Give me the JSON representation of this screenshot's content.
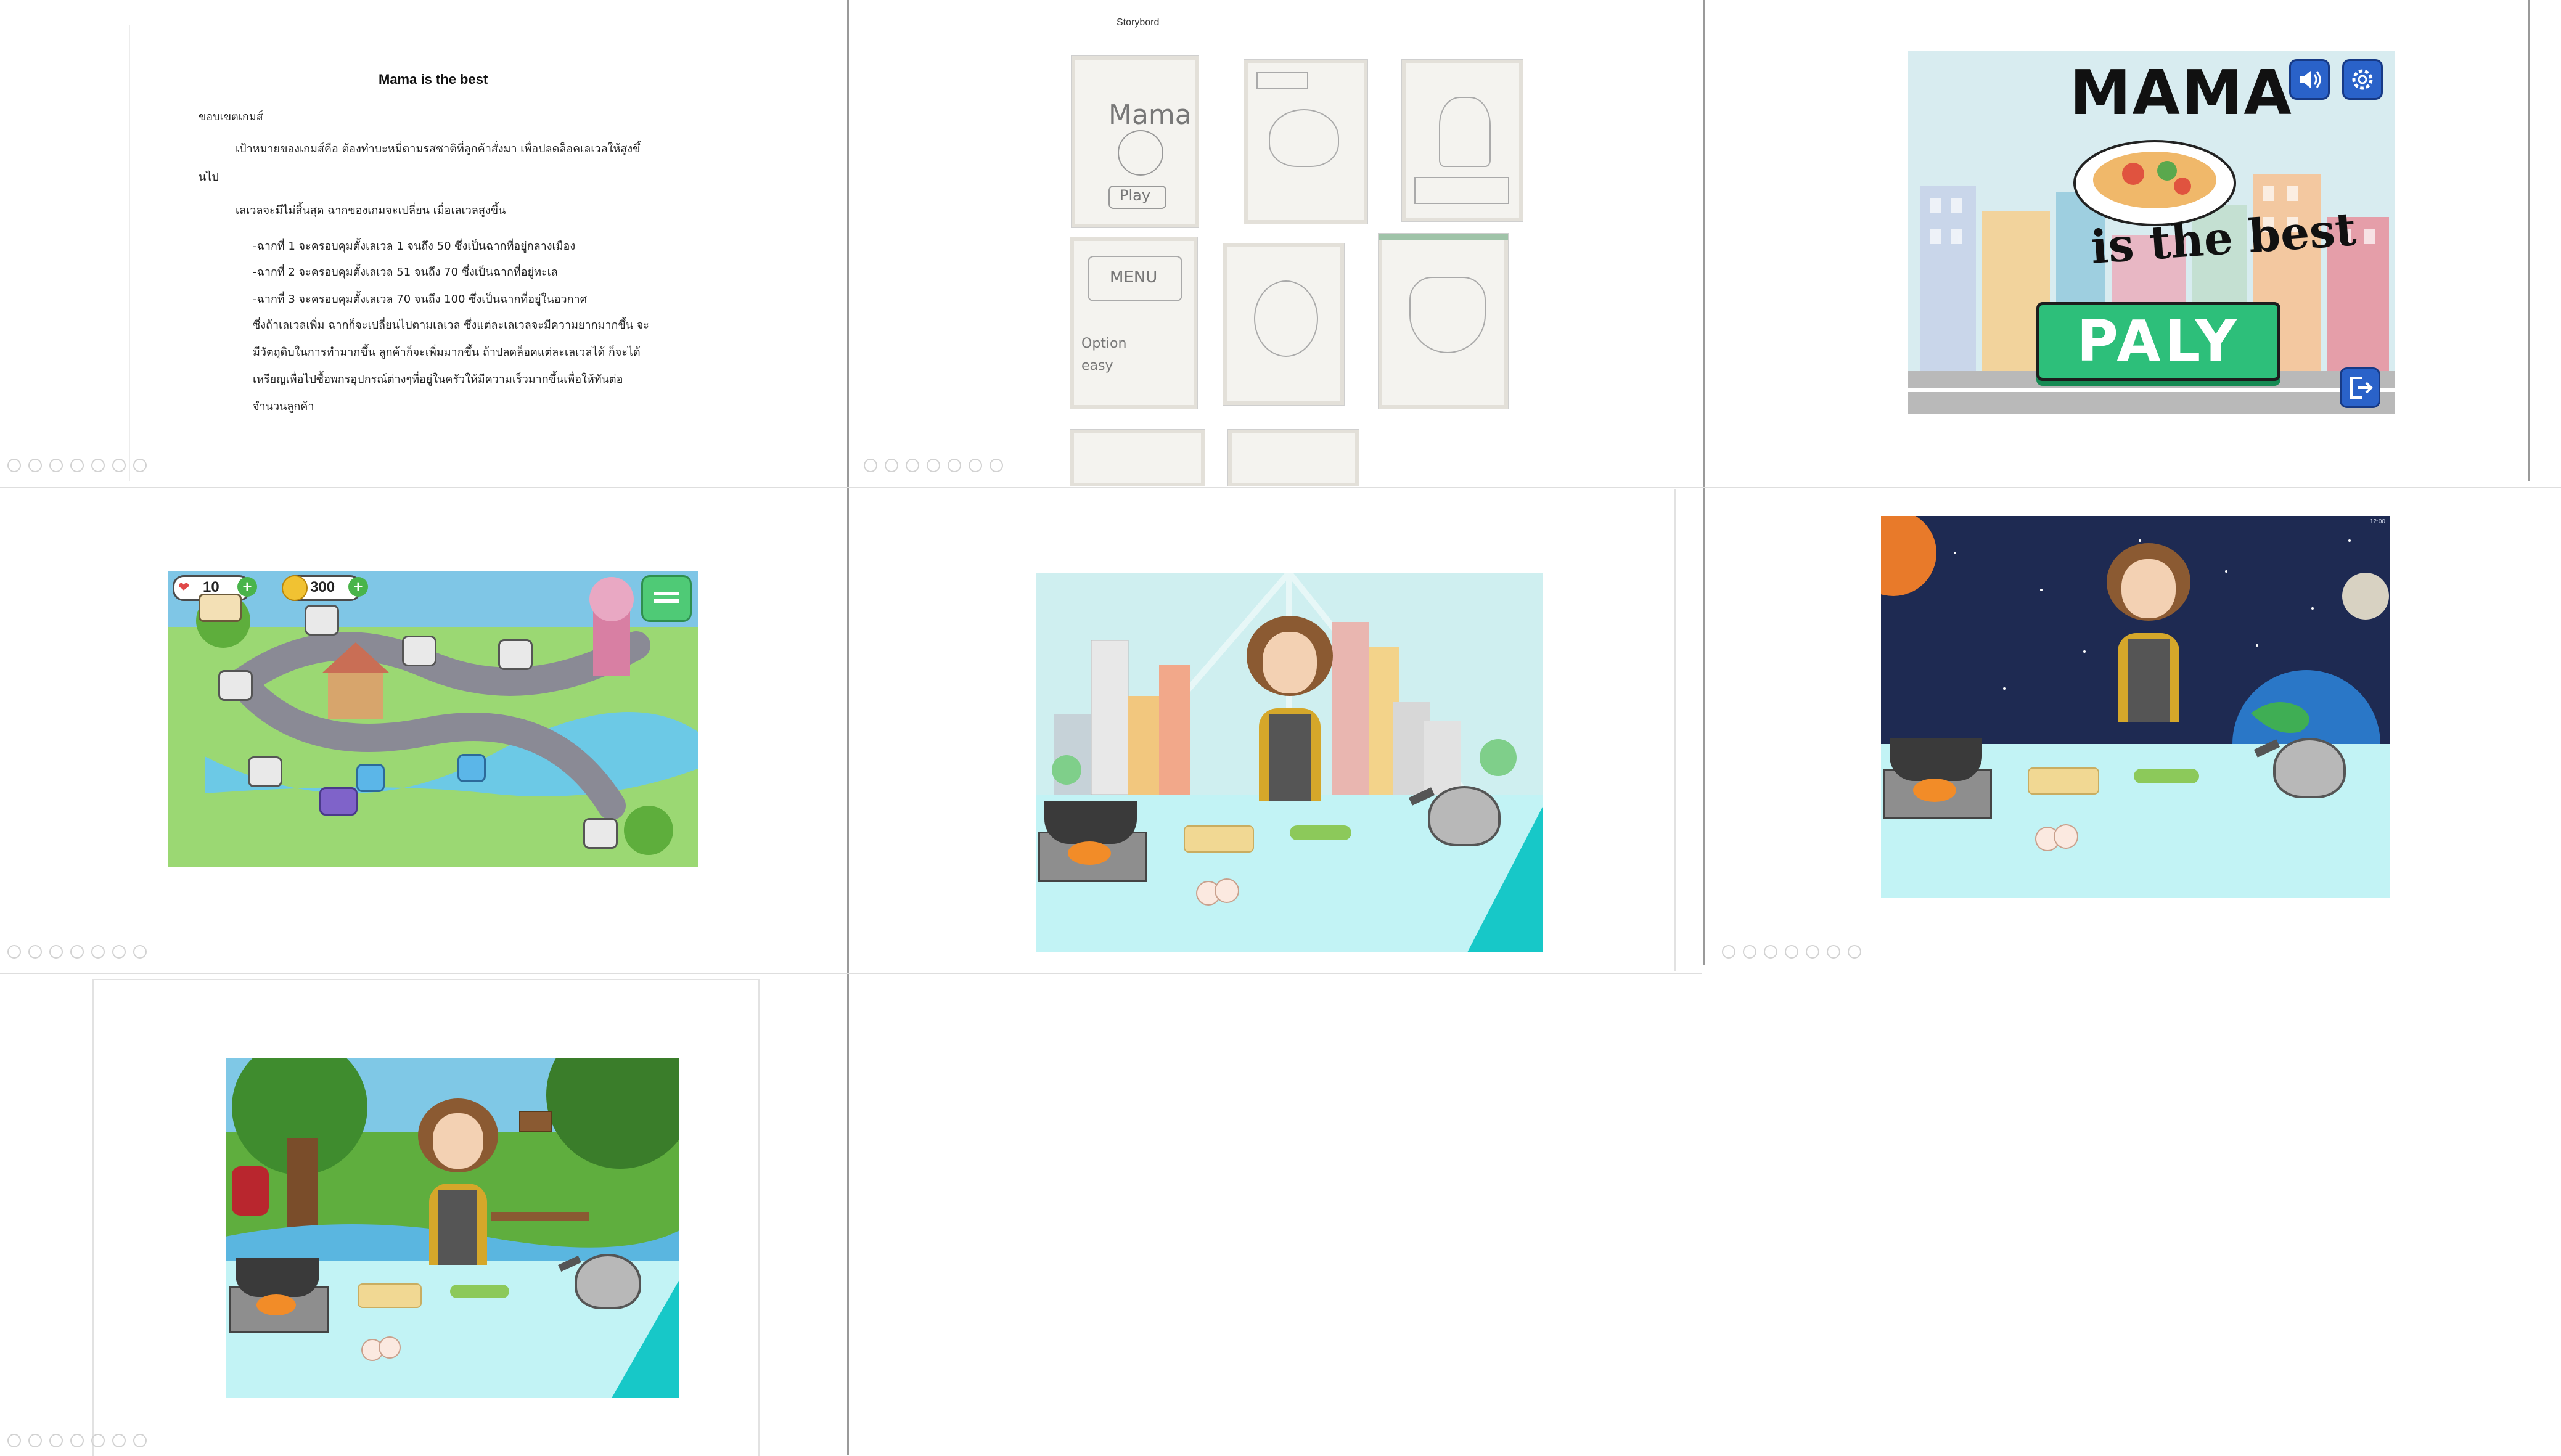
{
  "slides": {
    "doc": {
      "title": "Mama is the best",
      "section": "ขอบเขตเกมส์",
      "goal_line1": "เป้าหมายของเกมส์คือ ต้องทำบะหมี่ตามรสชาติที่ลูกค้าสั่งมา เพื่อปลดล็อคเลเวลให้สูงขึ้",
      "goal_line2": "นไป",
      "levels_intro": "เลเวลจะมีไม่สิ้นสุด ฉากของเกมจะเปลี่ยน เมื่อเลเวลสูงขึ้น",
      "level1": "-ฉากที่ 1 จะครอบคุมตั้งเลเวล 1 จนถึง 50 ซึ่งเป็นฉากที่อยู่กลางเมือง",
      "level2": "-ฉากที่ 2 จะครอบคุมตั้งเลเวล 51 จนถึง 70 ซึ่งเป็นฉากที่อยู่ทะเล",
      "level3": "-ฉากที่ 3 จะครอบคุมตั้งเลเวล 70 จนถึง 100 ซึ่งเป็นฉากที่อยู่ในอวกาศ",
      "para1": "ซึ่งถ้าเลเวลเพิ่ม ฉากก็จะเปลี่ยนไปตามเลเวล ซึ่งแต่ละเลเวลจะมีความยากมากขึ้น จะ",
      "para2": "มีวัตถุดิบในการทำมากขึ้น ลูกค้าก็จะเพิ่มมากขึ้น ถ้าปลดล็อคแต่ละเลเวลได้ ก็จะได้",
      "para3": "เหรียญเพื่อไปซื้อพกรอุปกรณ์ต่างๆที่อยู่ในครัวให้มีความเร็วมากขึ้นเพื่อให้ทันต่อ",
      "para4": "จำนวนลูกค้า"
    },
    "storyboard": {
      "title": "Storybord",
      "sketch_labels": [
        "Mama",
        "Play",
        "MENU",
        "Option",
        "easy"
      ]
    },
    "title_screen": {
      "logo_top": "MAMA",
      "logo_bottom": "is the best",
      "play_label": "PALY",
      "icons": [
        "speaker-icon",
        "settings-icon",
        "exit-icon"
      ]
    },
    "level_map": {
      "lives": "10",
      "coins": "300"
    },
    "space_scene": {
      "corner_label": "12:00"
    }
  },
  "colors": {
    "divider": "#9a9a9a",
    "sky_city": "#cfeff0",
    "counter": "#c2f3f5",
    "counter_accent": "#17c8c8",
    "space": "#1e2a52",
    "play_button": "#2dbf7a"
  }
}
